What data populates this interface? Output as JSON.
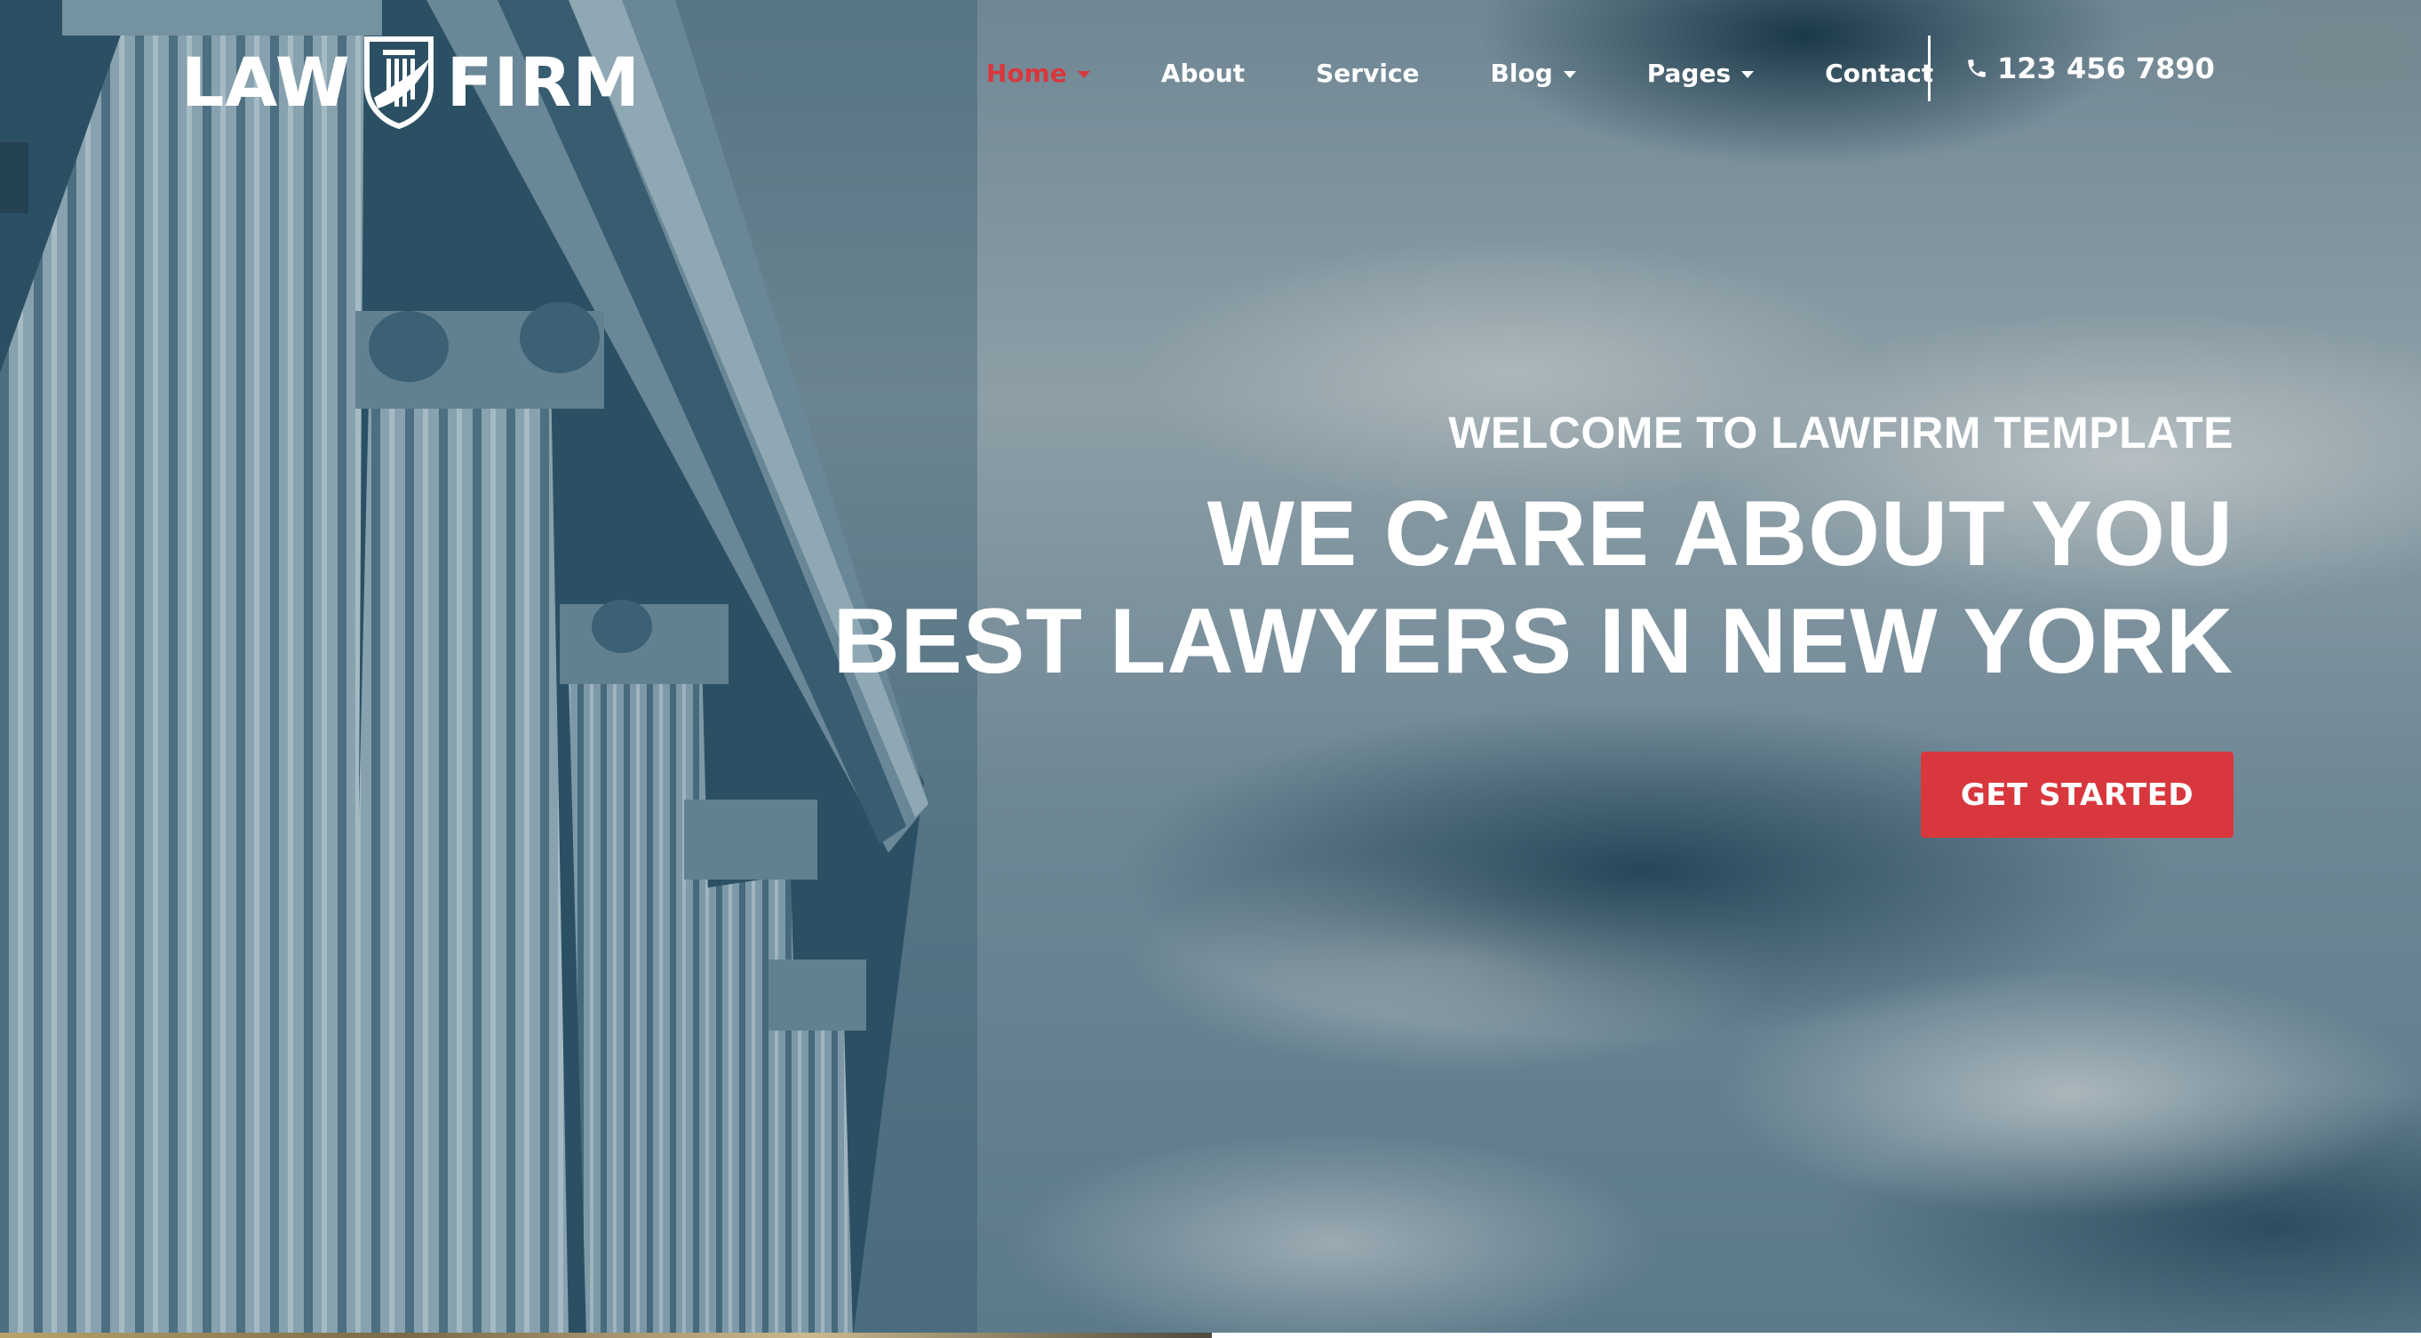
{
  "logo": {
    "left_text": "LAW",
    "right_text": "FIRM",
    "icon": "shield-icon"
  },
  "nav": {
    "items": [
      {
        "label": "Home",
        "active": true,
        "has_dropdown": true
      },
      {
        "label": "About",
        "active": false,
        "has_dropdown": false
      },
      {
        "label": "Service",
        "active": false,
        "has_dropdown": false
      },
      {
        "label": "Blog",
        "active": false,
        "has_dropdown": true
      },
      {
        "label": "Pages",
        "active": false,
        "has_dropdown": true
      },
      {
        "label": "Contact",
        "active": false,
        "has_dropdown": false
      }
    ],
    "phone": "123 456 7890",
    "phone_icon": "phone-icon"
  },
  "hero": {
    "welcome": "WELCOME TO LAWFIRM TEMPLATE",
    "headline_line1": "WE CARE ABOUT YOU",
    "headline_line2": "BEST LAWYERS IN NEW YORK",
    "cta_label": "GET STARTED"
  },
  "colors": {
    "accent": "#d8383d",
    "text": "#ffffff"
  }
}
